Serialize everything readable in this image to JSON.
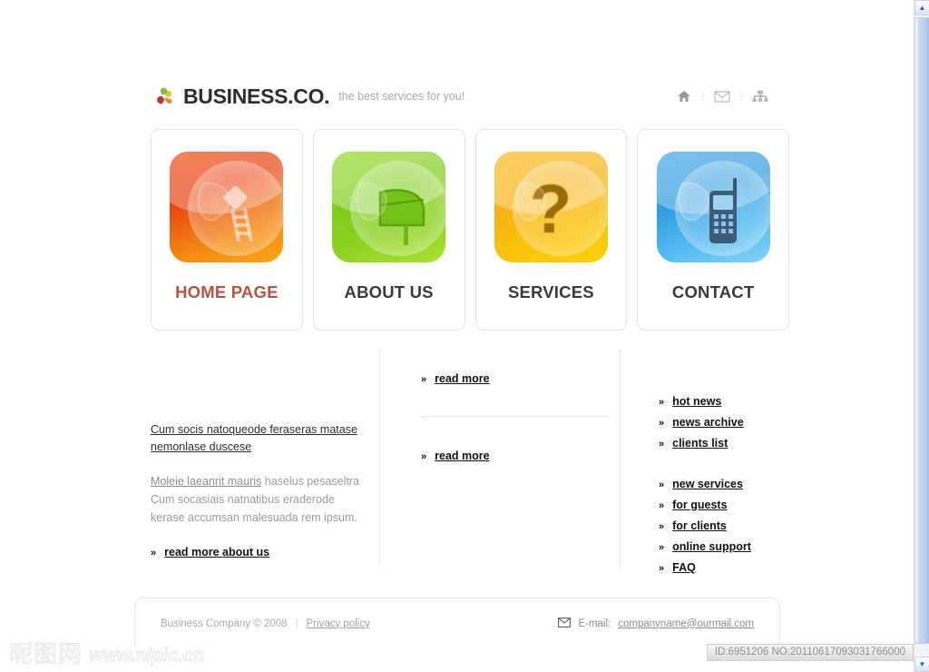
{
  "site": {
    "logo_icon": "pinwheel-logo-icon",
    "brand": "BUSINESS.CO.",
    "tagline": "the best services for you!"
  },
  "header_nav": {
    "items": [
      {
        "icon": "home-icon",
        "glyph": "⌂",
        "name": "home"
      },
      {
        "icon": "mail-icon",
        "glyph": "✉",
        "name": "mail"
      },
      {
        "icon": "sitemap-icon",
        "glyph": "⛭",
        "name": "sitemap"
      }
    ],
    "separator": "⋮"
  },
  "cards": [
    {
      "label": "HOME PAGE",
      "icon": "satellite-dish-icon",
      "active": true,
      "color_from": "#e8410f",
      "color_to": "#f7a212",
      "glyph_color": "#ffffff"
    },
    {
      "label": "ABOUT US",
      "icon": "mailbox-icon",
      "active": false,
      "color_from": "#7fcc1e",
      "color_to": "#a5e22c",
      "glyph_color": "#4f9a0d"
    },
    {
      "label": "SERVICES",
      "icon": "question-mark-icon",
      "active": false,
      "color_from": "#f7b115",
      "color_to": "#fbd20a",
      "glyph_color": "#8a6008"
    },
    {
      "label": "CONTACT",
      "icon": "mobile-phone-icon",
      "active": false,
      "color_from": "#2f9ce0",
      "color_to": "#7fd0f5",
      "glyph_color": "#2d4a63"
    }
  ],
  "content": {
    "left": {
      "lead": "Cum socis natoqueode feraseras matase nemonlase duscese",
      "paragraph_link": "Moleie laeanrit mauris",
      "paragraph_rest": " haselus pesaseltra Cum socasiais natnatibus eraderode kerase accumsan malesuada rem ipsum.",
      "read_more": "read more about us"
    },
    "middle": {
      "read_more_1": "read more",
      "read_more_2": "read more"
    },
    "right": {
      "group_1": [
        "hot news",
        "news archive",
        "clients list"
      ],
      "group_2": [
        "new services",
        "for guests",
        "for clients",
        "online support",
        "FAQ"
      ]
    },
    "chevron": "»"
  },
  "footer": {
    "copyright": "Business Company © 2008",
    "separator": "|",
    "privacy": "Privacy policy",
    "email_icon": "envelope-icon",
    "email_label": "E-mail:",
    "email_address": "companyname@ourmail.com"
  },
  "scrollbar": {
    "up_glyph": "▲",
    "down_glyph": "▼"
  },
  "watermark": {
    "cjk": "昵图网",
    "url": "www.nipic.cn",
    "id_badge": "ID:6951206 NO:20110617093031766000"
  }
}
